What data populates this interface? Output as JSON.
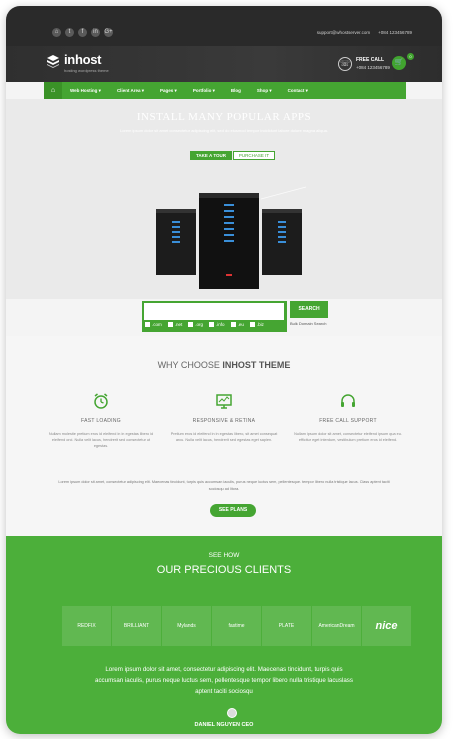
{
  "topbar": {
    "social_icons": [
      "home-icon",
      "twitter-icon",
      "facebook-icon",
      "linkedin-icon",
      "google-plus-icon"
    ],
    "social_glyphs": [
      "⌂",
      "t",
      "f",
      "in",
      "G+"
    ],
    "email": "support@whostserver.com",
    "phone": "+084 123456789"
  },
  "header": {
    "logo_text": "inhost",
    "logo_tagline": "hosting wordpress theme",
    "call_label": "FREE CALL",
    "call_number": "+084 123456789",
    "cart_count": "0"
  },
  "nav": {
    "items": [
      "Web Hosting ▾",
      "Client Area ▾",
      "Pages ▾",
      "Portfolio ▾",
      "Blog",
      "Shop ▾",
      "Contact ▾"
    ]
  },
  "hero": {
    "title": "INSTALL MANY POPULAR APPS",
    "subtitle": "Lorem ipsum dolor sit amet consectetur adipiscing elit, sed do eiusmod tempor incididunt labore dolore magna aliqua.",
    "tour_button": "TAKE A TOUR",
    "purchase_button": "PURCHASE IT"
  },
  "search": {
    "placeholder": "",
    "button": "SEARCH",
    "bulk_link": "Bulk Domain Search",
    "extensions": [
      ".com",
      ".net",
      ".org",
      ".info",
      ".eu",
      ".biz"
    ]
  },
  "why": {
    "title_light": "WHY CHOOSE ",
    "title_bold": "INHOST THEME",
    "features": [
      {
        "icon": "alarm-clock-icon",
        "title": "FAST LOADING",
        "desc": "Nullam molestie pretium eros id eleifend in in egestas libero id eleifend orci. Nulla velit lacus, hendrerit sed consectetur ut egestas."
      },
      {
        "icon": "monitor-icon",
        "title": "RESPONSIVE & RETINA",
        "desc": "Pretium eros id eleifend in in egestas libero, sit amet consequat arcu. Nulla velit lacus, hendrerit sed egestas eget sapien."
      },
      {
        "icon": "headset-icon",
        "title": "FREE CALL SUPPORT",
        "desc": "Nullam ipsum dolor sit amet, consectetur eleifend ipsum qua eu. efficitur eget interdum, vestibulum pretium eros id eleifend."
      }
    ],
    "paragraph": "Lorem ipsum dolor sit amet, consectetur adipiscing elit. Maecenas tincidunt, turpis quis accumsan iaculis, purus neque luctus sem, pellentesque. tempor libero nulla tristique lacus. Class aptent taciti sociosqu ad litora.",
    "plans_button": "SEE PLANS"
  },
  "clients": {
    "kicker": "SEE HOW",
    "title": "OUR PRECIOUS CLIENTS",
    "logos": [
      "REDFIX",
      "BRILLIANT",
      "Mylands",
      "fastime",
      "PLATE",
      "AmericanDream",
      "nice"
    ],
    "quote": "Lorem ipsum dolor sit amet, consectetur adipiscing elit. Maecenas tincidunt, turpis quis accumsan iaculis, purus neque luctus sem, pellentesque tempor libero nulla tristique lacuslass aptent taciti sociosqu",
    "author": "DANIEL NGUYEN CEO"
  },
  "colors": {
    "brand_green": "#45a532",
    "dark": "#2a2a2a"
  }
}
